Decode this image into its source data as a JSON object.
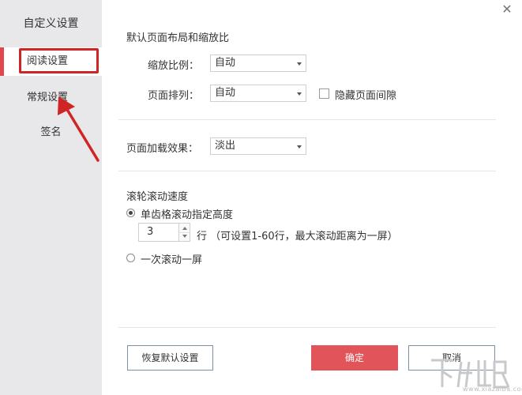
{
  "sidebar": {
    "title": "自定义设置",
    "items": [
      {
        "label": "阅读设置",
        "active": true
      },
      {
        "label": "常规设置",
        "active": false
      },
      {
        "label": "签名",
        "active": false
      }
    ]
  },
  "close_icon": "close-icon",
  "layout_section": {
    "title": "默认页面布局和缩放比",
    "zoom_label": "缩放比例：",
    "zoom_value": "自动",
    "arrange_label": "页面排列：",
    "arrange_value": "自动",
    "hide_gap_label": "隐藏页面间隙",
    "hide_gap_checked": false
  },
  "load_section": {
    "label": "页面加载效果：",
    "value": "淡出"
  },
  "scroll_section": {
    "title": "滚轮滚动速度",
    "option1_label": "单齿格滚动指定高度",
    "option1_checked": true,
    "rows_value": "3",
    "rows_hint": "行 （可设置1-60行，最大滚动距离为一屏）",
    "option2_label": "一次滚动一屏",
    "option2_checked": false
  },
  "footer": {
    "restore_label": "恢复默认设置",
    "ok_label": "确定",
    "cancel_label": "取消"
  },
  "watermark": {
    "text": "下载吧",
    "sub": "www.xiazaiba.com"
  },
  "colors": {
    "accent": "#e0464f",
    "annotation": "#d02525",
    "sidebar_bg": "#e8e7ea"
  }
}
